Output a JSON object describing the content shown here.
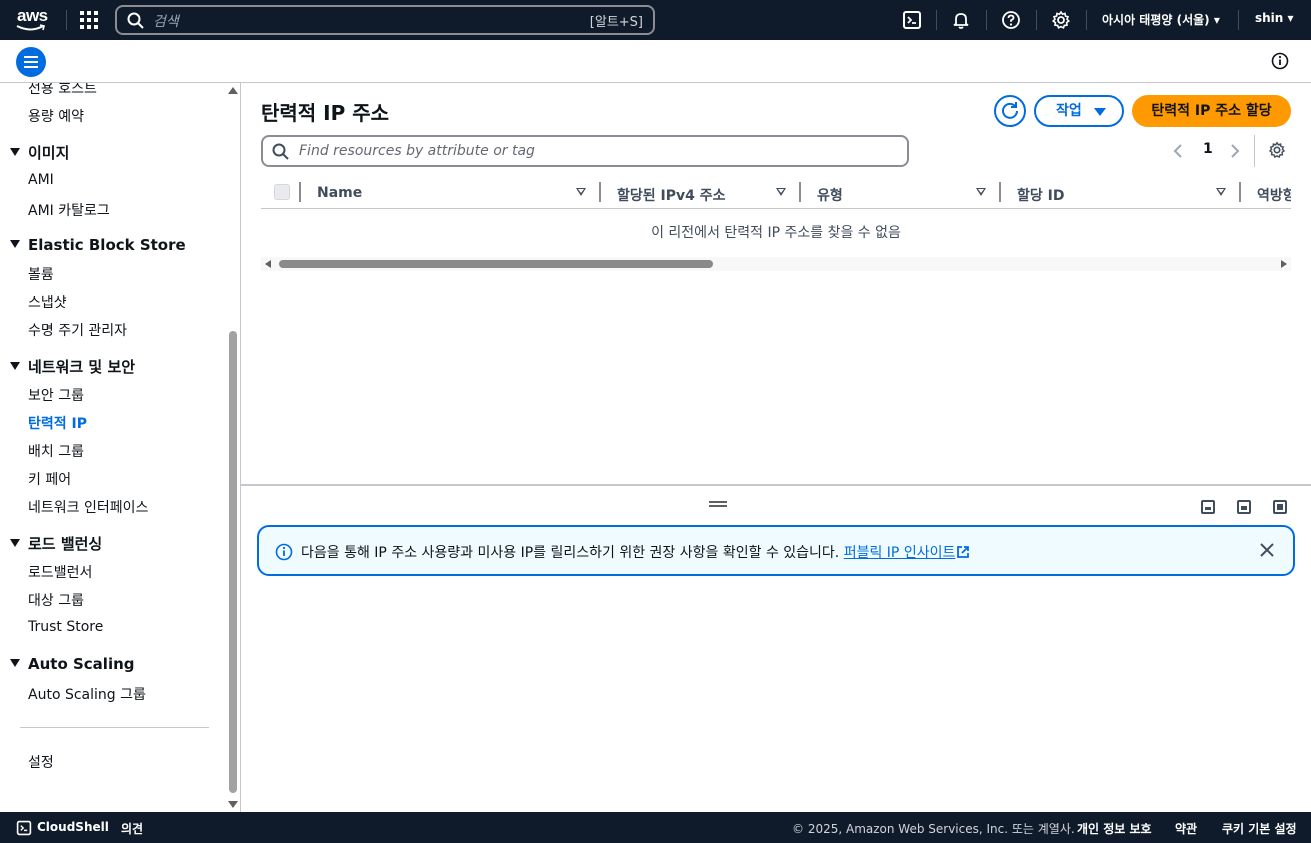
{
  "topnav": {
    "logo_text": "aws",
    "search_placeholder": "검색",
    "search_shortcut": "[알트+S]",
    "region": "아시아 태평양 (서울)",
    "user": "shin"
  },
  "sidebar": {
    "items": [
      {
        "type": "item",
        "label": "전용 호스트"
      },
      {
        "type": "item",
        "label": "용량 예약"
      },
      {
        "type": "section",
        "label": "이미지"
      },
      {
        "type": "item",
        "label": "AMI"
      },
      {
        "type": "item",
        "label": "AMI 카탈로그"
      },
      {
        "type": "section",
        "label": "Elastic Block Store"
      },
      {
        "type": "item",
        "label": "볼륨"
      },
      {
        "type": "item",
        "label": "스냅샷"
      },
      {
        "type": "item",
        "label": "수명 주기 관리자"
      },
      {
        "type": "section",
        "label": "네트워크 및 보안"
      },
      {
        "type": "item",
        "label": "보안 그룹"
      },
      {
        "type": "item",
        "label": "탄력적 IP",
        "active": true
      },
      {
        "type": "item",
        "label": "배치 그룹"
      },
      {
        "type": "item",
        "label": "키 페어"
      },
      {
        "type": "item",
        "label": "네트워크 인터페이스"
      },
      {
        "type": "section",
        "label": "로드 밸런싱"
      },
      {
        "type": "item",
        "label": "로드밸런서"
      },
      {
        "type": "item",
        "label": "대상 그룹"
      },
      {
        "type": "item",
        "label": "Trust Store"
      },
      {
        "type": "section",
        "label": "Auto Scaling"
      },
      {
        "type": "item",
        "label": "Auto Scaling 그룹"
      },
      {
        "type": "item",
        "label": "설정"
      }
    ]
  },
  "main": {
    "title": "탄력적 IP 주소",
    "actions_label": "작업",
    "primary_label": "탄력적 IP 주소 할당",
    "filter_placeholder": "Find resources by attribute or tag",
    "page_number": "1",
    "columns": [
      "Name",
      "할당된 IPv4 주소",
      "유형",
      "할당 ID",
      "역방향"
    ],
    "empty_message": "이 리전에서 탄력적 IP 주소를 찾을 수 없음"
  },
  "flash": {
    "message": "다음을 통해 IP 주소 사용량과 미사용 IP를 릴리스하기 위한 권장 사항을 확인할 수 있습니다.",
    "link_label": "퍼블릭 IP 인사이트"
  },
  "footer": {
    "cloudshell": "CloudShell",
    "feedback": "의견",
    "copyright": "© 2025, Amazon Web Services, Inc. 또는 계열사.",
    "privacy": "개인 정보 보호",
    "terms": "약관",
    "cookies": "쿠키 기본 설정"
  },
  "colors": {
    "nav_bg": "#0f1b2a",
    "accent": "#006ce0",
    "primary_button": "#ff9900",
    "flash_bg": "#f0fbff"
  },
  "icons": [
    "apps-grid-icon",
    "search-icon",
    "cloudshell-icon",
    "bell-icon",
    "help-icon",
    "gear-icon",
    "menu-icon",
    "info-icon",
    "refresh-icon",
    "chevron-left-icon",
    "chevron-right-icon",
    "external-link-icon",
    "close-icon"
  ]
}
